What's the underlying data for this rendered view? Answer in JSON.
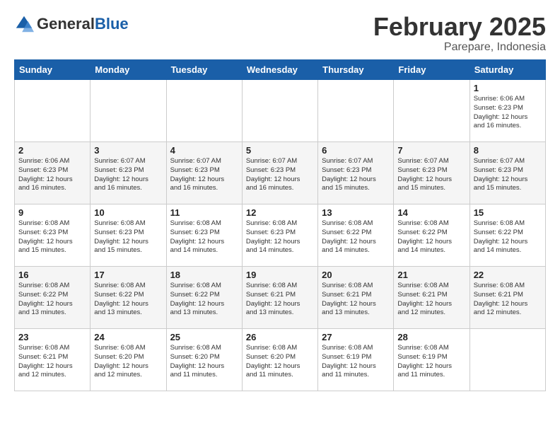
{
  "header": {
    "logo_general": "General",
    "logo_blue": "Blue",
    "month_title": "February 2025",
    "location": "Parepare, Indonesia"
  },
  "weekdays": [
    "Sunday",
    "Monday",
    "Tuesday",
    "Wednesday",
    "Thursday",
    "Friday",
    "Saturday"
  ],
  "weeks": [
    [
      {
        "day": "",
        "info": ""
      },
      {
        "day": "",
        "info": ""
      },
      {
        "day": "",
        "info": ""
      },
      {
        "day": "",
        "info": ""
      },
      {
        "day": "",
        "info": ""
      },
      {
        "day": "",
        "info": ""
      },
      {
        "day": "1",
        "info": "Sunrise: 6:06 AM\nSunset: 6:23 PM\nDaylight: 12 hours\nand 16 minutes."
      }
    ],
    [
      {
        "day": "2",
        "info": "Sunrise: 6:06 AM\nSunset: 6:23 PM\nDaylight: 12 hours\nand 16 minutes."
      },
      {
        "day": "3",
        "info": "Sunrise: 6:07 AM\nSunset: 6:23 PM\nDaylight: 12 hours\nand 16 minutes."
      },
      {
        "day": "4",
        "info": "Sunrise: 6:07 AM\nSunset: 6:23 PM\nDaylight: 12 hours\nand 16 minutes."
      },
      {
        "day": "5",
        "info": "Sunrise: 6:07 AM\nSunset: 6:23 PM\nDaylight: 12 hours\nand 16 minutes."
      },
      {
        "day": "6",
        "info": "Sunrise: 6:07 AM\nSunset: 6:23 PM\nDaylight: 12 hours\nand 15 minutes."
      },
      {
        "day": "7",
        "info": "Sunrise: 6:07 AM\nSunset: 6:23 PM\nDaylight: 12 hours\nand 15 minutes."
      },
      {
        "day": "8",
        "info": "Sunrise: 6:07 AM\nSunset: 6:23 PM\nDaylight: 12 hours\nand 15 minutes."
      }
    ],
    [
      {
        "day": "9",
        "info": "Sunrise: 6:08 AM\nSunset: 6:23 PM\nDaylight: 12 hours\nand 15 minutes."
      },
      {
        "day": "10",
        "info": "Sunrise: 6:08 AM\nSunset: 6:23 PM\nDaylight: 12 hours\nand 15 minutes."
      },
      {
        "day": "11",
        "info": "Sunrise: 6:08 AM\nSunset: 6:23 PM\nDaylight: 12 hours\nand 14 minutes."
      },
      {
        "day": "12",
        "info": "Sunrise: 6:08 AM\nSunset: 6:23 PM\nDaylight: 12 hours\nand 14 minutes."
      },
      {
        "day": "13",
        "info": "Sunrise: 6:08 AM\nSunset: 6:22 PM\nDaylight: 12 hours\nand 14 minutes."
      },
      {
        "day": "14",
        "info": "Sunrise: 6:08 AM\nSunset: 6:22 PM\nDaylight: 12 hours\nand 14 minutes."
      },
      {
        "day": "15",
        "info": "Sunrise: 6:08 AM\nSunset: 6:22 PM\nDaylight: 12 hours\nand 14 minutes."
      }
    ],
    [
      {
        "day": "16",
        "info": "Sunrise: 6:08 AM\nSunset: 6:22 PM\nDaylight: 12 hours\nand 13 minutes."
      },
      {
        "day": "17",
        "info": "Sunrise: 6:08 AM\nSunset: 6:22 PM\nDaylight: 12 hours\nand 13 minutes."
      },
      {
        "day": "18",
        "info": "Sunrise: 6:08 AM\nSunset: 6:22 PM\nDaylight: 12 hours\nand 13 minutes."
      },
      {
        "day": "19",
        "info": "Sunrise: 6:08 AM\nSunset: 6:21 PM\nDaylight: 12 hours\nand 13 minutes."
      },
      {
        "day": "20",
        "info": "Sunrise: 6:08 AM\nSunset: 6:21 PM\nDaylight: 12 hours\nand 13 minutes."
      },
      {
        "day": "21",
        "info": "Sunrise: 6:08 AM\nSunset: 6:21 PM\nDaylight: 12 hours\nand 12 minutes."
      },
      {
        "day": "22",
        "info": "Sunrise: 6:08 AM\nSunset: 6:21 PM\nDaylight: 12 hours\nand 12 minutes."
      }
    ],
    [
      {
        "day": "23",
        "info": "Sunrise: 6:08 AM\nSunset: 6:21 PM\nDaylight: 12 hours\nand 12 minutes."
      },
      {
        "day": "24",
        "info": "Sunrise: 6:08 AM\nSunset: 6:20 PM\nDaylight: 12 hours\nand 12 minutes."
      },
      {
        "day": "25",
        "info": "Sunrise: 6:08 AM\nSunset: 6:20 PM\nDaylight: 12 hours\nand 11 minutes."
      },
      {
        "day": "26",
        "info": "Sunrise: 6:08 AM\nSunset: 6:20 PM\nDaylight: 12 hours\nand 11 minutes."
      },
      {
        "day": "27",
        "info": "Sunrise: 6:08 AM\nSunset: 6:19 PM\nDaylight: 12 hours\nand 11 minutes."
      },
      {
        "day": "28",
        "info": "Sunrise: 6:08 AM\nSunset: 6:19 PM\nDaylight: 12 hours\nand 11 minutes."
      },
      {
        "day": "",
        "info": ""
      }
    ]
  ]
}
